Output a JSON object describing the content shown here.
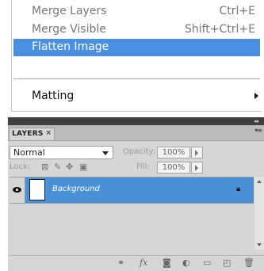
{
  "menu": {
    "items": [
      {
        "label": "Merge Layers",
        "shortcut": "Ctrl+E"
      },
      {
        "label": "Merge Visible",
        "shortcut": "Shift+Ctrl+E"
      },
      {
        "label": "Flatten Image",
        "shortcut": ""
      },
      {
        "label": "Matting",
        "shortcut": ""
      }
    ],
    "highlight_color": "#4a90e2"
  },
  "layers_panel": {
    "tab_label": "LAYERS",
    "tab_close": "×",
    "collapse_glyph": "◂◂",
    "menu_glyph": "▾≡",
    "blend_mode": "Normal",
    "opacity_label": "Opacity:",
    "opacity_value": "100%",
    "lock_label": "Lock:",
    "fill_label": "Fill:",
    "fill_value": "100%",
    "lock_icons": [
      "lock-transparent-icon",
      "lock-paint-icon",
      "lock-move-icon",
      "lock-all-icon"
    ],
    "layers": [
      {
        "name": "Background",
        "visible": true,
        "locked": true
      }
    ],
    "footer_icons": [
      "link-layers-icon",
      "fx-icon",
      "add-mask-icon",
      "adjustment-layer-icon",
      "new-group-icon",
      "new-layer-icon",
      "trash-icon"
    ],
    "fx_glyph": "fx",
    "selection_color": "#4a90d9"
  }
}
